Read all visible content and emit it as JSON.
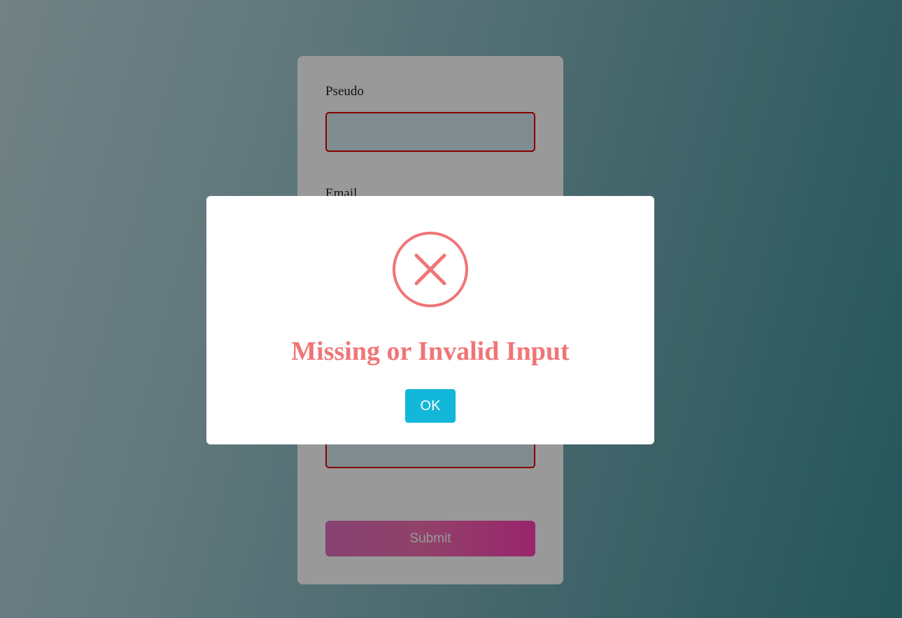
{
  "form": {
    "fields": [
      {
        "label": "Pseudo",
        "value": ""
      },
      {
        "label": "Email",
        "value": ""
      },
      {
        "label": "",
        "value": ""
      }
    ],
    "submit_label": "Submit"
  },
  "modal": {
    "icon": "error-x-circle-icon",
    "title": "Missing or Invalid Input",
    "ok_label": "OK"
  },
  "colors": {
    "error": "#f07577",
    "ok_button": "#13b7d9",
    "input_border_error": "#e00000",
    "submit_gradient": [
      "#e06fbf",
      "#ff3fb5"
    ]
  }
}
